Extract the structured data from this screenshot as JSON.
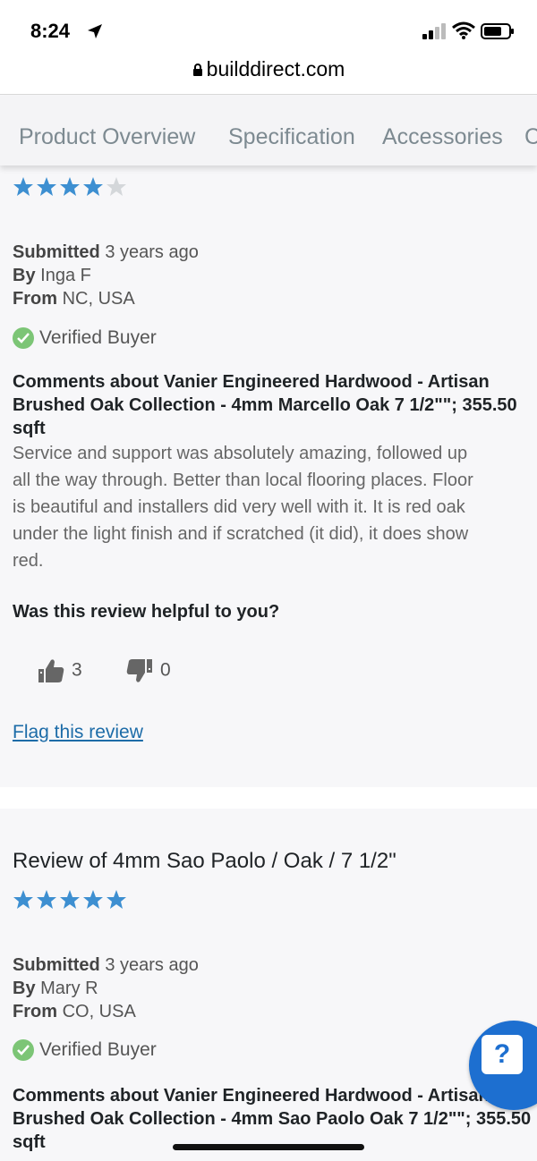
{
  "status_bar": {
    "time": "8:24"
  },
  "url_bar": {
    "domain": "builddirect.com"
  },
  "tabs": [
    {
      "label": "Product Overview"
    },
    {
      "label": "Specification"
    },
    {
      "label": "Accessories"
    },
    {
      "label": "C"
    }
  ],
  "reviews": [
    {
      "rating": 4,
      "max_rating": 5,
      "submitted_label": "Submitted",
      "submitted_value": "3 years ago",
      "by_label": "By",
      "by_value": "Inga F",
      "from_label": "From",
      "from_value": "NC, USA",
      "verified": "Verified Buyer",
      "comment_title_lines": [
        "Comments about Vanier Engineered Hardwood - Artisan",
        "Brushed Oak Collection - 4mm Marcello Oak 7 1/2\"\"; 355.50",
        "sqft"
      ],
      "body_lines": [
        "Service and support was absolutely amazing, followed up",
        "all the way through. Better than local flooring places. Floor",
        "is beautiful and installers did very well with it. It is red oak",
        "under the light finish and if scratched (it did), it does show",
        "red."
      ],
      "helpful_question": "Was this review helpful to you?",
      "thumbs_up_count": "3",
      "thumbs_down_count": "0",
      "flag_label": "Flag this review"
    },
    {
      "title": "Review of 4mm Sao Paolo / Oak / 7 1/2\"",
      "rating": 5,
      "max_rating": 5,
      "submitted_label": "Submitted",
      "submitted_value": "3 years ago",
      "by_label": "By",
      "by_value": "Mary R",
      "from_label": "From",
      "from_value": "CO, USA",
      "verified": "Verified Buyer",
      "comment_title_lines": [
        "Comments about Vanier Engineered Hardwood - Artisan",
        "Brushed Oak Collection - 4mm Sao Paolo Oak 7 1/2\"\"; 355.50",
        "sqft"
      ]
    }
  ],
  "help_widget": {
    "label": "?"
  },
  "colors": {
    "star_filled": "#3d8fd1",
    "star_empty": "#d4d7da",
    "link": "#1d6ca8",
    "verified_check": "#7cc576",
    "help_bubble": "#1d6fd0"
  },
  "icons": [
    "location-arrow-icon",
    "signal-icon",
    "wifi-icon",
    "battery-icon",
    "lock-icon",
    "star-icon",
    "checkmark-icon",
    "thumbs-up-icon",
    "thumbs-down-icon",
    "help-chat-icon"
  ]
}
